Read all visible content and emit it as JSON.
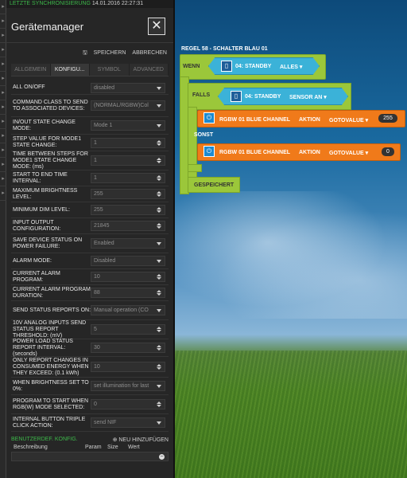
{
  "sync": {
    "label": "LETZTE SYNCHRONISIERUNG",
    "time": "14.01.2016 22:27:31"
  },
  "panel": {
    "title": "Gerätemanager",
    "save": "SPEICHERN",
    "cancel": "ABBRECHEN"
  },
  "tabs": [
    "ALLGEMEIN",
    "KONFIGU...",
    "SYMBOL",
    "ADVANCED"
  ],
  "config_rows": [
    {
      "label": "ALL ON/OFF",
      "value": "disabled",
      "kind": "sel"
    },
    {
      "label": "COMMAND CLASS TO SEND TO ASSOCIATED DEVICES:",
      "value": "(NORMAL/RGBW)Col",
      "kind": "sel"
    },
    {
      "label": "IN/OUT STATE CHANGE MODE:",
      "value": "Mode 1",
      "kind": "sel"
    },
    {
      "label": "STEP VALUE FOR MODE1 STATE CHANGE:",
      "value": "1",
      "kind": "num"
    },
    {
      "label": "TIME BETWEEN STEPS FOR MODE1 STATE CHANGE MODE: (ms)",
      "value": "1",
      "kind": "num"
    },
    {
      "label": "START TO END TIME INTERVAL:",
      "value": "1",
      "kind": "num"
    },
    {
      "label": "MAXIMUM BRIGHTNESS LEVEL:",
      "value": "255",
      "kind": "num"
    },
    {
      "label": "MINIMUM DIM LEVEL:",
      "value": "255",
      "kind": "num"
    },
    {
      "label": "INPUT OUTPUT CONFIGURATION:",
      "value": "21845",
      "kind": "num"
    },
    {
      "label": "SAVE DEVICE STATUS ON POWER FAILURE:",
      "value": "Enabled",
      "kind": "sel"
    },
    {
      "label": "ALARM MODE:",
      "value": "Disabled",
      "kind": "sel"
    },
    {
      "label": "CURRENT ALARM PROGRAM:",
      "value": "10",
      "kind": "num"
    },
    {
      "label": "CURRENT ALARM PROGRAM DURATION:",
      "value": "88",
      "kind": "num"
    },
    {
      "label": "SEND STATUS REPORTS ON:",
      "value": "Manual operation (CO",
      "kind": "sel"
    },
    {
      "label": "10V ANALOG INPUTS SEND STATUS REPORT THRESHOLD: (mV)",
      "value": "5",
      "kind": "num"
    },
    {
      "label": "POWER LOAD STATUS REPORT INTERVAL: (seconds)",
      "value": "30",
      "kind": "num"
    },
    {
      "label": "ONLY REPORT CHANGES IN CONSUMED ENERGY WHEN THEY EXCEED: (0.1 kWh)",
      "value": "10",
      "kind": "num"
    },
    {
      "label": "WHEN BRIGHTNESS SET TO 0%:",
      "value": "set illumination for last",
      "kind": "sel"
    },
    {
      "label": "PROGRAM TO START WHEN RGB(W) MODE SELECTED:",
      "value": "0",
      "kind": "num"
    },
    {
      "label": "INTERNAL BUTTON TRIPLE CLICK ACTION:",
      "value": "send NIF",
      "kind": "sel"
    }
  ],
  "benutzer": {
    "title": "BENUTZERDEF. KONFIG.",
    "add": "NEU HINZUFÜGEN",
    "cols": [
      "Beschreibung",
      "Param",
      "Size",
      "Wert"
    ]
  },
  "rule": {
    "title": "REGEL 58 - SCHALTER BLAU 01",
    "wenn": "WENN",
    "falls": "FALLS",
    "sonst": "SONST",
    "gespeichert": "GESPEICHERT",
    "standby1": "04: STANDBY",
    "alles": "ALLES ▾",
    "standby2": "04: STANDBY",
    "sensor": "SENSOR AN ▾",
    "rgbw1": "RGBW 01 BLUE CHANNEL",
    "aktion1": "AKTION",
    "gotovalue1": "GOTOVALUE ▾",
    "val1": "255",
    "rgbw2": "RGBW 01 BLUE CHANNEL",
    "aktion2": "AKTION",
    "gotovalue2": "GOTOVALUE ▾",
    "val2": "0"
  }
}
